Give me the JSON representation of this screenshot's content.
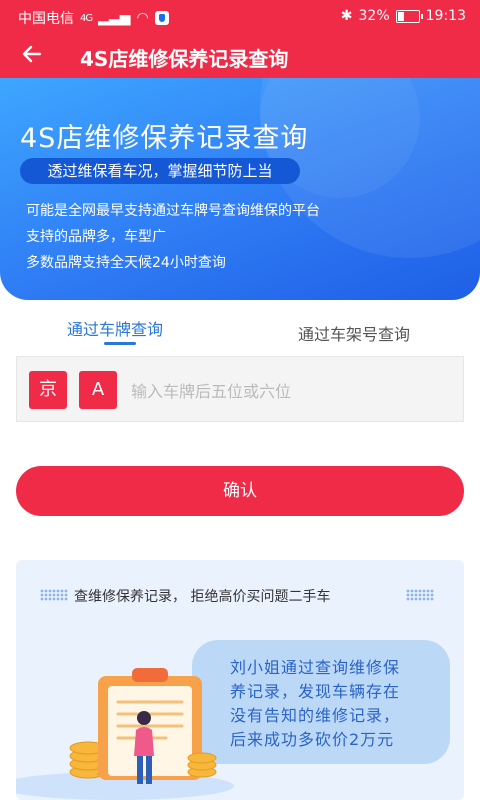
{
  "status_bar": {
    "carrier": "中国电信",
    "network": "4G",
    "battery": "32%",
    "battery_fraction": 0.32,
    "time": "19:13"
  },
  "header": {
    "title": "4S店维修保养记录查询"
  },
  "banner": {
    "headline": "4S店维修保养记录查询",
    "tagline": "透过维保看车况，掌握细节防上当",
    "features": [
      "可能是全网最早支持通过车牌号查询维保的平台",
      "支持的品牌多，车型广",
      "多数品牌支持全天候24小时查询"
    ]
  },
  "tabs": [
    {
      "label": "通过车牌查询",
      "active": true
    },
    {
      "label": "通过车架号查询",
      "active": false
    }
  ],
  "plate": {
    "province": "京",
    "letter": "A",
    "placeholder": "输入车牌后五位或六位"
  },
  "confirm_label": "确认",
  "info": {
    "tagline": "查维修保养记录， 拒绝高价买问题二手车",
    "story_lines": [
      "刘小姐通过查询维修保",
      "养记录，发现车辆存在",
      "没有告知的维修记录，",
      "后来成功多砍价2万元"
    ]
  },
  "colors": {
    "brand_red": "#f02b48",
    "banner_blue": "#2f7cf4",
    "tab_active": "#2a77d8",
    "card_bg": "#eaf2fd"
  }
}
